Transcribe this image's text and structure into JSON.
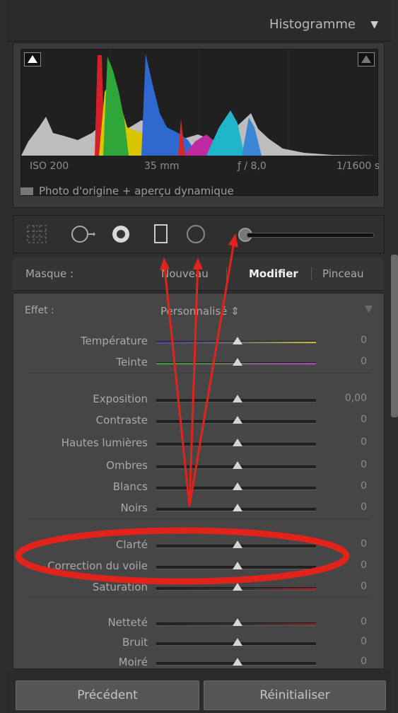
{
  "header": {
    "title": "Histogramme",
    "toggle_icon": "triangle-down-icon"
  },
  "histogram": {
    "exif": {
      "iso": "ISO 200",
      "focal": "35 mm",
      "aperture": "ƒ / 8,0",
      "shutter": "1/1600 s"
    },
    "origine_label": "Photo d'origine + aperçu dynamique"
  },
  "tools": {
    "icons": [
      "crop-overlay-icon",
      "spot-removal-icon",
      "red-eye-icon",
      "graduated-filter-icon",
      "radial-filter-icon",
      "adjustment-brush-icon"
    ]
  },
  "mask": {
    "label": "Masque :",
    "options": {
      "nouveau": "Nouveau",
      "modifier": "Modifier",
      "pinceau": "Pinceau"
    },
    "active": "Modifier"
  },
  "effect": {
    "label": "Effet :",
    "preset": "Personnalisé",
    "groups": [
      [
        {
          "label": "Température",
          "value": "0"
        },
        {
          "label": "Teinte",
          "value": "0"
        }
      ],
      [
        {
          "label": "Exposition",
          "value": "0,00"
        },
        {
          "label": "Contraste",
          "value": "0"
        },
        {
          "label": "Hautes lumières",
          "value": "0"
        },
        {
          "label": "Ombres",
          "value": "0"
        },
        {
          "label": "Blancs",
          "value": "0"
        },
        {
          "label": "Noirs",
          "value": "0"
        }
      ],
      [
        {
          "label": "Clarté",
          "value": "0"
        },
        {
          "label": "Correction du voile",
          "value": "0"
        },
        {
          "label": "Saturation",
          "value": "0"
        }
      ],
      [
        {
          "label": "Netteté",
          "value": "0"
        },
        {
          "label": "Bruit",
          "value": "0"
        },
        {
          "label": "Moiré",
          "value": "0"
        }
      ]
    ]
  },
  "buttons": {
    "previous": "Précédent",
    "reset": "Réinitialiser"
  },
  "colors": {
    "annotation": "#e0231b",
    "temperature": "#c8c23a",
    "tint": "#b03cc0",
    "saturation": "#a01e2e"
  }
}
